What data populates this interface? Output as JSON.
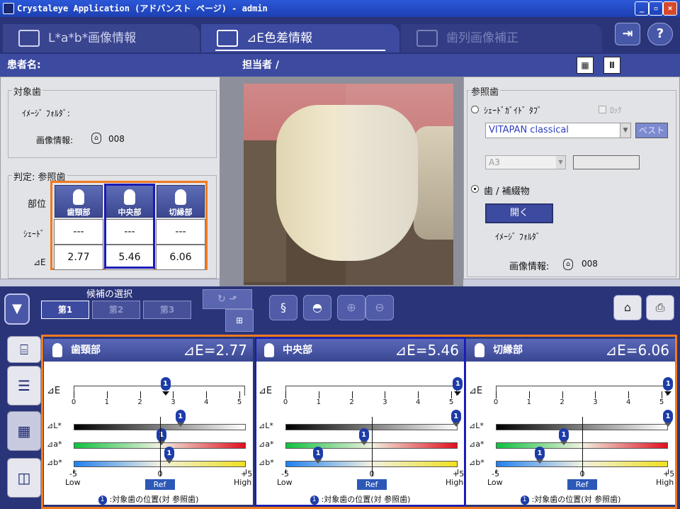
{
  "window": {
    "title": "Crystaleye Application (アドバンスト ページ) - admin",
    "btn_min": "_",
    "btn_max": "▫",
    "btn_close": "×"
  },
  "tabs": [
    {
      "label": "L*a*b*画像情報"
    },
    {
      "label": "⊿E色差情報"
    },
    {
      "label": "歯列画像補正"
    }
  ],
  "header": {
    "exit_icon": "exit-icon",
    "help_label": "?"
  },
  "patient": {
    "name_label": "患者名:",
    "staff_label": "担当者 /"
  },
  "target": {
    "title": "対象歯",
    "folder_label": "ｲﾒｰｼﾞ ﾌｫﾙﾀﾞ:",
    "info_label": "画像情報:",
    "info_value": "008"
  },
  "judgement": {
    "title": "判定: 参照歯",
    "row_part": "部位",
    "row_shade": "ｼｪｰﾄﾞ",
    "row_de": "⊿E",
    "zones": [
      {
        "name": "歯頸部",
        "shade": "---",
        "de": "2.77"
      },
      {
        "name": "中央部",
        "shade": "---",
        "de": "5.46"
      },
      {
        "name": "切縁部",
        "shade": "---",
        "de": "6.06"
      }
    ]
  },
  "reference": {
    "title": "参照歯",
    "shade_tab_label": "ｼｪｰﾄﾞｶﾞｲﾄﾞ ﾀﾌﾞ",
    "lock_label": "ﾛｯｸ",
    "guide_value": "VITAPAN classical",
    "best_btn": "ベスト",
    "shade_value": "A3",
    "tooth_label": "歯 / 補綴物",
    "open_btn": "開く",
    "folder_label": "ｲﾒｰｼﾞ ﾌｫﾙﾀﾞ",
    "info_label": "画像情報:",
    "info_value": "008"
  },
  "candidates": {
    "title": "候補の選択",
    "items": [
      "第1",
      "第2",
      "第3"
    ]
  },
  "charts": [
    {
      "zone": "歯頸部",
      "de_label": "⊿E=",
      "de": "2.77",
      "de_value": 2.77,
      "dL": 1.2,
      "da": 0.1,
      "db": 0.55
    },
    {
      "zone": "中央部",
      "de_label": "⊿E=",
      "de": "5.46",
      "de_value": 5.46,
      "dL": 4.9,
      "da": -0.45,
      "db": -3.1
    },
    {
      "zone": "切縁部",
      "de_label": "⊿E=",
      "de": "6.06",
      "de_value": 6.06,
      "dL": 5.0,
      "da": -1.05,
      "db": -2.45
    }
  ],
  "chart_labels": {
    "de": "⊿E",
    "dL": "⊿L*",
    "da": "⊿a*",
    "db": "⊿b*",
    "low": "Low",
    "high": "High",
    "ref": "Ref",
    "minus5": "-5",
    "zero": "0",
    "plus5": "+5",
    "ticks": [
      "0",
      "1",
      "2",
      "3",
      "4",
      "5"
    ],
    "marker": "1",
    "legend": ":対象歯の位置(対 参照歯)"
  },
  "colors": {
    "accent": "#3c4aa0",
    "orange": "#f07a20",
    "blue_sel": "#1a1ab8"
  }
}
